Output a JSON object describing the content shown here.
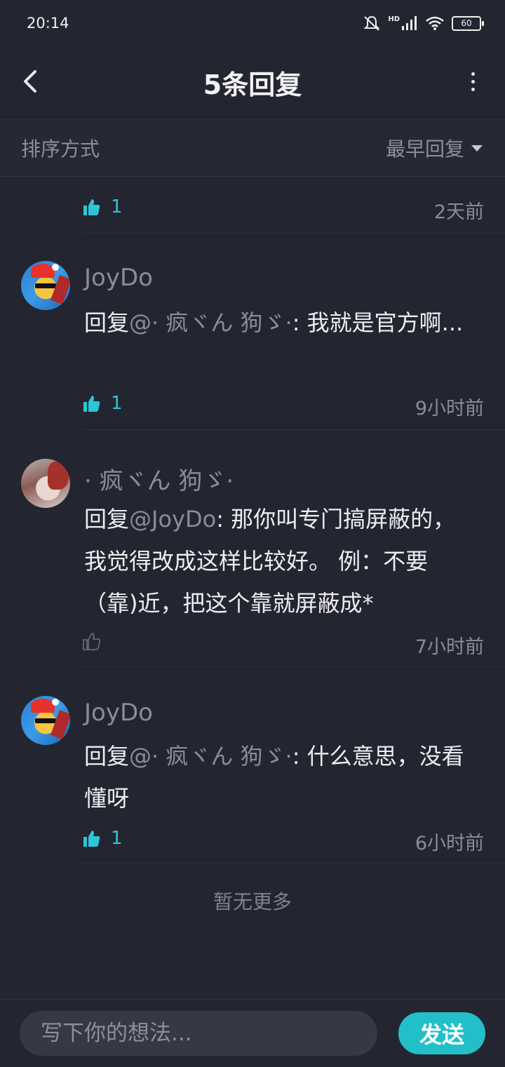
{
  "status": {
    "time": "20:14",
    "battery": "60",
    "hd": "HD"
  },
  "header": {
    "title": "5条回复"
  },
  "sort": {
    "label": "排序方式",
    "selected": "最早回复"
  },
  "replies": [
    {
      "likes": "1",
      "time": "2天前",
      "liked": true
    },
    {
      "user": "JoyDo",
      "prefix": "回复",
      "mention": "@· 疯ヾん 狗ゞ·",
      "sep": ": ",
      "text": "我就是官方啊...",
      "likes": "1",
      "time": "9小时前",
      "liked": true
    },
    {
      "user": "· 疯ヾん 狗ゞ·",
      "prefix": "回复",
      "mention": "@JoyDo",
      "sep": ": ",
      "text": "那你叫专门搞屏蔽的，我觉得改成这样比较好。 例：不要（靠)近，把这个靠就屏蔽成*",
      "likes": "",
      "time": "7小时前",
      "liked": false
    },
    {
      "user": "JoyDo",
      "prefix": "回复",
      "mention": "@· 疯ヾん 狗ゞ·",
      "sep": ": ",
      "text": "什么意思，没看懂呀",
      "likes": "1",
      "time": "6小时前",
      "liked": true
    }
  ],
  "footer": {
    "no_more": "暂无更多"
  },
  "composer": {
    "placeholder": "写下你的想法...",
    "send": "发送"
  },
  "colors": {
    "accent": "#22bfc9",
    "background": "#232530",
    "muted": "#8a8d98"
  },
  "icons": {
    "back": "chevron-left-icon",
    "more": "more-vertical-icon",
    "like": "thumbs-up-icon",
    "sort": "caret-down-icon"
  }
}
